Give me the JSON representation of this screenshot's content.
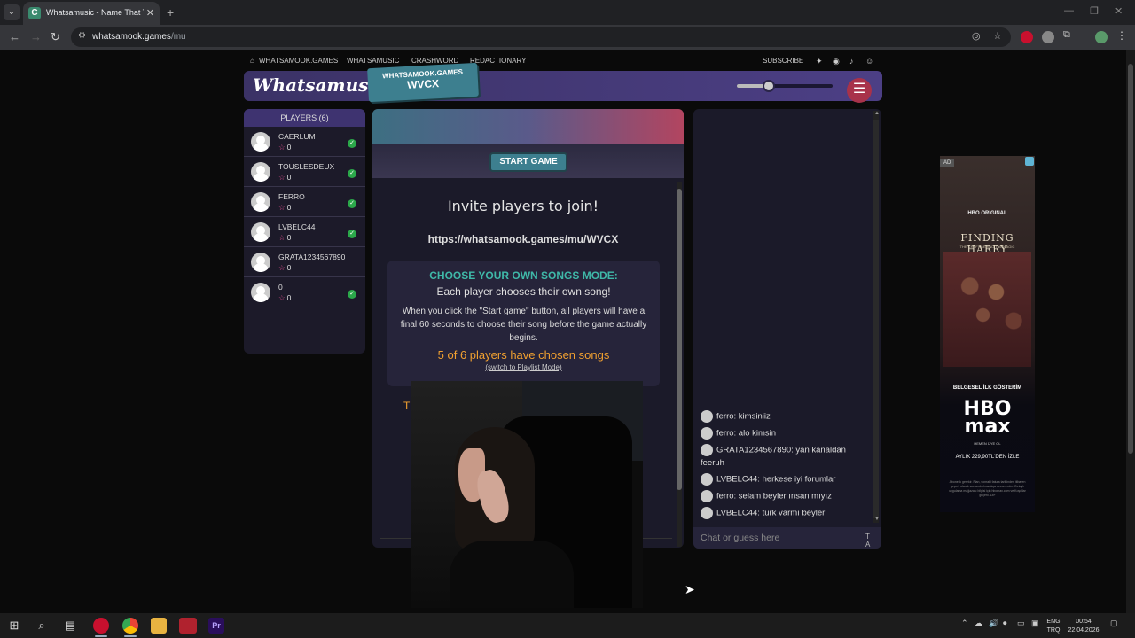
{
  "browser": {
    "tab_title": "Whatsamusic - Name That Tune",
    "tab_favicon": "C",
    "url_domain": "whatsamook.games",
    "url_path": "/mu"
  },
  "topnav": {
    "home": "WHATSAMOOK.GAMES",
    "links": [
      "WHATSAMUSIC",
      "CRASHWORD",
      "REDACTIONARY"
    ],
    "subscribe": "SUBSCRIBE"
  },
  "banner": {
    "logo": "Whatsamusic",
    "room_site": "WHATSAMOOK.GAMES",
    "room_code": "WVCX"
  },
  "volume": {
    "level": 0.33
  },
  "players": {
    "header": "PLAYERS (6)",
    "list": [
      {
        "name": "CAERLUM",
        "score": "0",
        "ready": true
      },
      {
        "name": "TOUSLESDEUX",
        "score": "0",
        "ready": true
      },
      {
        "name": "FERRO",
        "score": "0",
        "ready": true
      },
      {
        "name": "LVBELC44",
        "score": "0",
        "ready": true
      },
      {
        "name": "GRATA1234567890",
        "score": "0",
        "ready": false
      },
      {
        "name": "0",
        "score": "0",
        "ready": true
      }
    ]
  },
  "game": {
    "start_button": "START GAME",
    "invite_heading": "Invite players to join!",
    "invite_url": "https://whatsamook.games/mu/WVCX",
    "mode_title": "CHOOSE YOUR OWN SONGS MODE:",
    "mode_subtitle": "Each player chooses their own song!",
    "mode_description": "When you click the \"Start game\" button, all players will have a final 60 seconds to choose their song before the game actually begins.",
    "songs_chosen": "5 of 6 players have chosen songs",
    "switch_mode": "(switch to Playlist Mode)",
    "partial_text": "T"
  },
  "chat": {
    "messages": [
      {
        "text": "ferro: kimsiniiz"
      },
      {
        "text": "ferro: alo kimsin"
      },
      {
        "text": "GRATA1234567890: yan kanaldan feeruh"
      },
      {
        "text": "LVBELC44: herkese iyi forumlar"
      },
      {
        "text": "ferro: selam beyler ınsan mıyız"
      },
      {
        "text": "LVBELC44: türk varmı beyler"
      }
    ],
    "placeholder": "Chat or guess here",
    "text_tools": "T A"
  },
  "ad": {
    "label": "AD",
    "network": "HBO ORIGINAL",
    "title": "FINDING HARRY",
    "tagline": "THE CRAFT BEHIND THE MAGIC",
    "promo": "BELGESEL İLK GÖSTERİM",
    "brand": "HBO max",
    "cta": "HEMEN ÜYE OL",
    "price": "AYLIK 229,90TL'DEN İZLE",
    "fine_print": "Abonelik gerekir. Plan, sonraki fatura tarihinden itibaren geçerli olarak sonlandırılmadıkça devam eder. Detaylı uygulama mağazası bilgisi için hbomax.com ve Koşullar geçerli. 18+"
  },
  "taskbar": {
    "language": "ENG",
    "region": "TRQ",
    "time": "00:54",
    "date": "22.04.2026"
  },
  "colors": {
    "banner": "#4c3f85",
    "accent_teal": "#3d7f8f",
    "mode_title": "#3fb8a8",
    "songs_count": "#f0a030",
    "ready_check": "#2ba84a",
    "star": "#d84b8a"
  }
}
